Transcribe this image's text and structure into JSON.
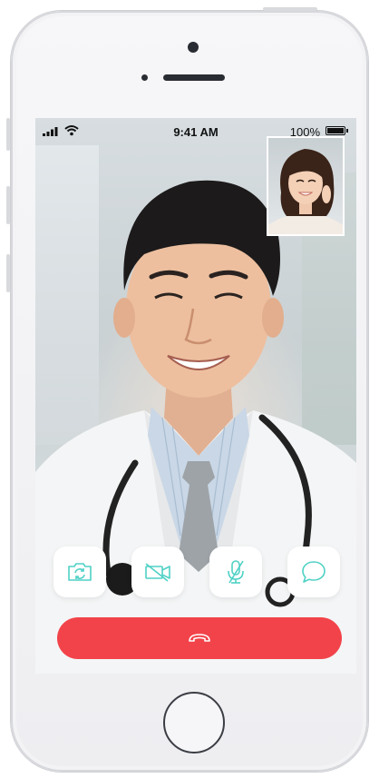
{
  "status_bar": {
    "time": "9:41 AM",
    "battery_text": "100%",
    "signal_icon": "signal-bars-icon",
    "wifi_icon": "wifi-icon",
    "battery_level": 1.0
  },
  "call": {
    "remote_participant_image": "doctor-portrait",
    "self_preview_image": "woman-portrait"
  },
  "controls": [
    {
      "name": "switch-camera-button",
      "icon": "camera-switch-icon"
    },
    {
      "name": "video-off-button",
      "icon": "video-off-icon"
    },
    {
      "name": "mute-button",
      "icon": "mic-off-icon"
    },
    {
      "name": "chat-button",
      "icon": "chat-bubble-icon"
    }
  ],
  "end_call": {
    "icon": "hang-up-icon"
  },
  "colors": {
    "accent": "#4fd1c5",
    "end_call": "#f2434a",
    "control_bg": "#ffffff"
  }
}
